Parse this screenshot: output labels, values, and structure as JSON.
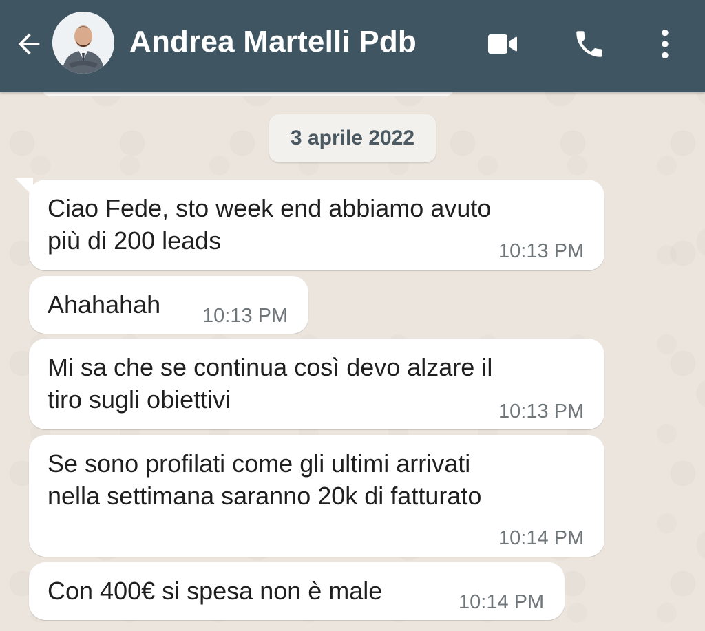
{
  "header": {
    "contact_name": "Andrea Martelli Pdb",
    "background_color": "#3f5561",
    "icons": {
      "back": "arrow-left-icon",
      "video": "video-camera-icon",
      "call": "phone-icon",
      "menu": "more-vertical-icon"
    }
  },
  "chat": {
    "date_separator": "3 aprile 2022",
    "messages": [
      {
        "text": "Ciao Fede, sto week end abbiamo avuto\npiù di 200 leads",
        "time": "10:13 PM"
      },
      {
        "text": "Ahahahah",
        "time": "10:13 PM"
      },
      {
        "text": "Mi sa che se continua così devo alzare il\ntiro sugli obiettivi",
        "time": "10:13 PM"
      },
      {
        "text": "Se sono profilati come gli ultimi arrivati\nnella settimana saranno 20k di fatturato",
        "time": "10:14 PM"
      },
      {
        "text": "Con 400€ si spesa non è male",
        "time": "10:14 PM"
      }
    ]
  },
  "colors": {
    "wallpaper": "#ece5dd",
    "incoming_bubble": "#ffffff",
    "timestamp": "#6f7679"
  }
}
